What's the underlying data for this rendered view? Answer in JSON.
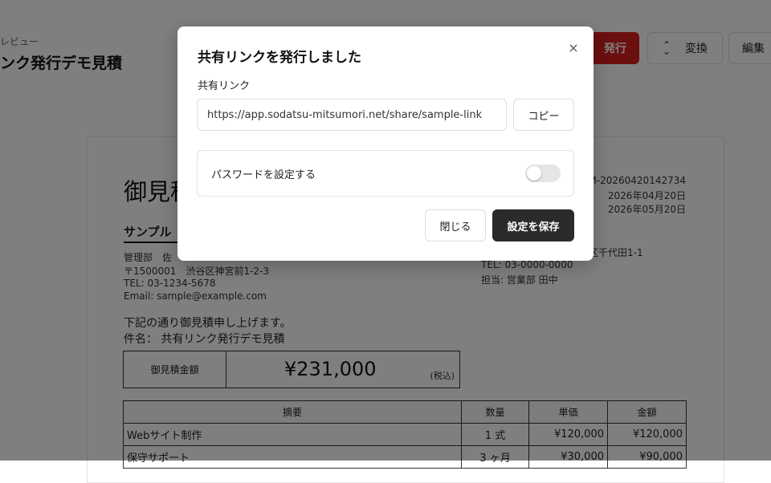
{
  "header": {
    "breadcrumb": "レビュー",
    "title": "ンク発行デモ見積",
    "issue_button": "発行",
    "convert_button": "変換",
    "edit_button": "編集"
  },
  "document": {
    "title": "御見積",
    "number": "SM-20260420142734",
    "issue_date": "2026年04月20日",
    "expiry_date": "2026年05月20日",
    "client_name": "サンプル",
    "client_dept": "管理部　佐",
    "client_zip": "〒1500001　渋谷区神宮前1-2-3",
    "client_tel": "TEL: 03-1234-5678",
    "client_email": "Email: sample@example.com",
    "issuer_address": "区千代田1-1",
    "issuer_tel": "TEL: 03-0000-0000",
    "issuer_contact": "担当: 営業部 田中",
    "greeting": "下記の通り御見積申し上げます。",
    "subject": "件名： 共有リンク発行デモ見積",
    "total_label": "御見積金額",
    "total_amount": "¥231,000",
    "total_tax": "(税込)",
    "table": {
      "headers": [
        "摘要",
        "数量",
        "単価",
        "金額"
      ],
      "rows": [
        {
          "desc": "Webサイト制作",
          "qty": "1 式",
          "unit": "¥120,000",
          "amount": "¥120,000"
        },
        {
          "desc": "保守サポート",
          "qty": "3 ヶ月",
          "unit": "¥30,000",
          "amount": "¥90,000"
        }
      ]
    }
  },
  "modal": {
    "title": "共有リンクを発行しました",
    "close_icon": "×",
    "link_label": "共有リンク",
    "link_value": "https://app.sodatsu-mitsumori.net/share/sample-link",
    "copy_button": "コピー",
    "password_label": "パスワードを設定する",
    "password_enabled": false,
    "close_button": "閉じる",
    "save_button": "設定を保存"
  }
}
